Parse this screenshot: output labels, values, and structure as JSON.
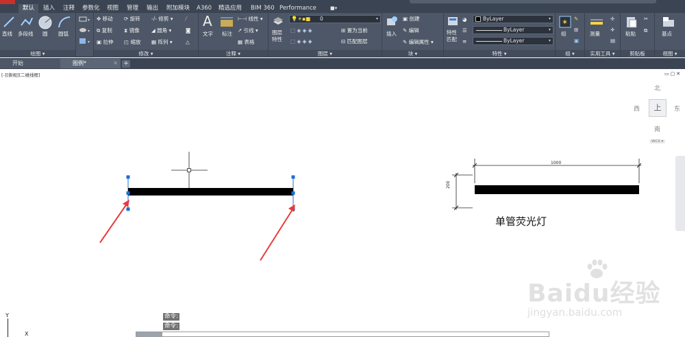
{
  "ribbon_tabs": [
    "默认",
    "插入",
    "注释",
    "参数化",
    "视图",
    "管理",
    "输出",
    "附加模块",
    "A360",
    "精选应用",
    "BIM 360",
    "Performance"
  ],
  "groups": {
    "draw": {
      "title": "绘图 ▾",
      "tools": [
        "直线",
        "多段线",
        "圆",
        "圆弧"
      ]
    },
    "modify": {
      "title": "修改 ▾",
      "tools": [
        "移动",
        "旋转",
        "修剪",
        "复制",
        "镜像",
        "圆角",
        "拉伸",
        "缩放",
        "阵列"
      ]
    },
    "annotation": {
      "title": "注释 ▾",
      "tools": [
        "文字",
        "标注",
        "线性",
        "引线",
        "表格"
      ]
    },
    "layers": {
      "title": "图层 ▾",
      "layer_props": "图层\n特性",
      "layer_value": "0",
      "set_current": "置为当前",
      "match_layer": "匹配图层"
    },
    "block": {
      "title": "块 ▾",
      "insert": "插入",
      "create": "创建",
      "edit": "编辑",
      "edit_attr": "编辑属性"
    },
    "properties": {
      "title": "特性 ▾",
      "match": "特性\n匹配",
      "color": "ByLayer",
      "linetype": "ByLayer",
      "lineweight": "ByLayer"
    },
    "group": {
      "title": "组 ▾",
      "label": "组"
    },
    "utilities": {
      "title": "实用工具 ▾",
      "measure": "测量"
    },
    "clipboard": {
      "title": "剪贴板",
      "paste": "粘贴"
    },
    "view": {
      "title": "视图 ▾",
      "base": "基点"
    }
  },
  "file_tabs": [
    {
      "label": "开始",
      "active": false
    },
    {
      "label": "图例*",
      "active": true
    }
  ],
  "viewport_label": "[-][俯视][二维线框]",
  "viewcube": {
    "north": "北",
    "south": "南",
    "east": "东",
    "west": "西",
    "top": "上",
    "wcs": "WCS ▾"
  },
  "drawing": {
    "dim_width": "1000",
    "dim_height": "200",
    "label": "单管荧光灯"
  },
  "command_lines": [
    "命令:",
    "命令:"
  ],
  "ucs": {
    "x": "X",
    "y": "Y"
  },
  "watermark": {
    "main": "Baidu经验",
    "sub": "jingyan.baidu.com"
  },
  "colors": {
    "ribbon_bg": "#4d5767",
    "tab_bg": "#3b4453",
    "grip": "#1f6fd1",
    "arrow": "#e83b3b"
  }
}
